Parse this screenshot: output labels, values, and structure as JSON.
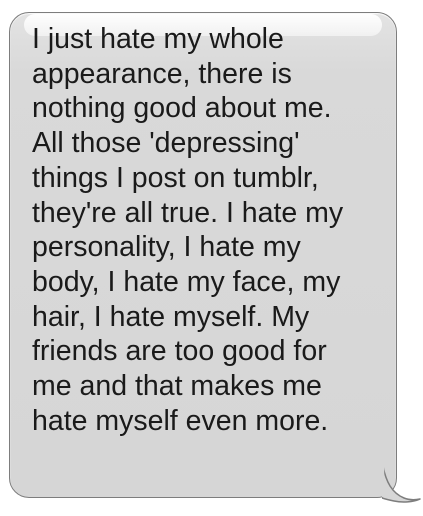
{
  "message": {
    "text": "I just hate my whole\nappearance, there is\nnothing good about me.\nAll those 'depressing'\nthings I post on tumblr,\nthey're all true. I hate my\npersonality, I hate my\nbody, I hate my face, my\nhair, I hate myself. My\nfriends are too good for\nme and that makes me\nhate myself even more.",
    "bubble_color": "#d6d6d6",
    "border_color": "#7d7d7d",
    "text_color": "#1a1a1a"
  }
}
